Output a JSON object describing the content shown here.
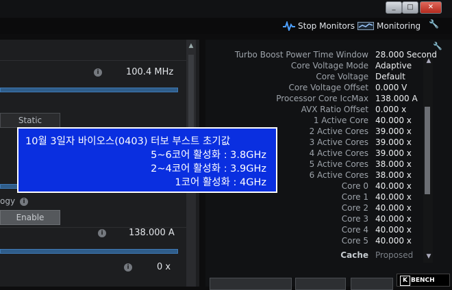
{
  "window": {
    "minimize": "_",
    "maximize": "□",
    "close": "✕"
  },
  "toolbar": {
    "stop_monitors": "Stop Monitors",
    "monitoring": "Monitoring",
    "wrench": "🔧"
  },
  "left_panel": {
    "value1": "100.4 MHz",
    "mode_label": "Static",
    "partial_label": "ogy",
    "enable_label": "Enable",
    "value2": "138.000 A",
    "value3": "0 x",
    "info_glyph": "i"
  },
  "right_panel": {
    "rows": [
      {
        "label": "Turbo Boost Power Time Window",
        "value": "28.000 Second"
      },
      {
        "label": "Core Voltage Mode",
        "value": "Adaptive"
      },
      {
        "label": "Core Voltage",
        "value": "Default"
      },
      {
        "label": "Core Voltage Offset",
        "value": "0.000 V"
      },
      {
        "label": "Processor Core IccMax",
        "value": "138.000 A"
      },
      {
        "label": "AVX Ratio Offset",
        "value": "0.000 x"
      },
      {
        "label": "1 Active Core",
        "value": "40.000 x"
      },
      {
        "label": "2 Active Cores",
        "value": "39.000 x"
      },
      {
        "label": "3 Active Cores",
        "value": "39.000 x"
      },
      {
        "label": "4 Active Cores",
        "value": "39.000 x"
      },
      {
        "label": "5 Active Cores",
        "value": "38.000 x"
      },
      {
        "label": "6 Active Cores",
        "value": "38.000 x"
      },
      {
        "label": "Core 0",
        "value": "40.000 x"
      },
      {
        "label": "Core 1",
        "value": "40.000 x"
      },
      {
        "label": "Core 2",
        "value": "40.000 x"
      },
      {
        "label": "Core 3",
        "value": "40.000 x"
      },
      {
        "label": "Core 4",
        "value": "40.000 x"
      },
      {
        "label": "Core 5",
        "value": "40.000 x"
      }
    ],
    "cache": {
      "label": "Cache",
      "value": "Proposed"
    }
  },
  "annotation": {
    "line1": "10월 3일자 바이오스(0403) 터보 부스트 초기값",
    "line2": "5~6코어 활성화 : 3.8GHz",
    "line3": "2~4코어 활성화 : 3.9GHz",
    "line4": "1코어 활성화 : 4GHz"
  },
  "logo": {
    "text": "BENCH",
    "mark": "K"
  },
  "colors": {
    "annotation_bg": "#0a2fe0",
    "panel_bg": "#1d1e20",
    "accent_blue": "#3f79b4"
  }
}
